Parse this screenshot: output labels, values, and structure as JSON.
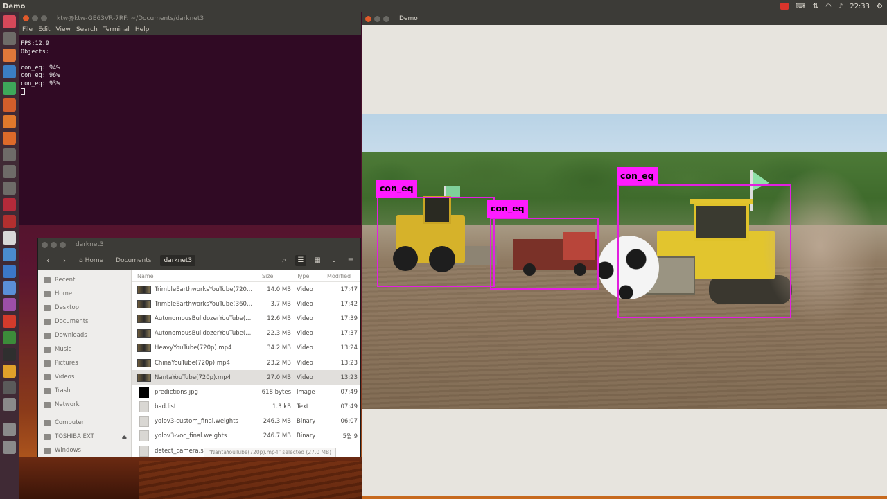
{
  "top_panel": {
    "title": "Demo",
    "clock": "22:33"
  },
  "terminal": {
    "title": "ktw@ktw-GE63VR-7RF: ~/Documents/darknet3",
    "menu": [
      "File",
      "Edit",
      "View",
      "Search",
      "Terminal",
      "Help"
    ],
    "lines": [
      "FPS:12.9",
      "Objects:",
      "",
      "con_eq: 94%",
      "con_eq: 96%",
      "con_eq: 93%"
    ]
  },
  "file_manager": {
    "title": "darknet3",
    "breadcrumb": [
      "Home",
      "Documents",
      "darknet3"
    ],
    "sidebar": [
      {
        "label": "Recent",
        "icon": "clock-icon"
      },
      {
        "label": "Home",
        "icon": "home-icon"
      },
      {
        "label": "Desktop",
        "icon": "folder-icon"
      },
      {
        "label": "Documents",
        "icon": "folder-icon"
      },
      {
        "label": "Downloads",
        "icon": "folder-icon"
      },
      {
        "label": "Music",
        "icon": "music-icon"
      },
      {
        "label": "Pictures",
        "icon": "picture-icon"
      },
      {
        "label": "Videos",
        "icon": "video-icon"
      },
      {
        "label": "Trash",
        "icon": "trash-icon"
      },
      {
        "label": "Network",
        "icon": "network-icon"
      },
      {
        "label": "Computer",
        "icon": "computer-icon"
      },
      {
        "label": "TOSHIBA EXT",
        "icon": "drive-icon"
      },
      {
        "label": "Windows",
        "icon": "drive-icon"
      }
    ],
    "columns": {
      "name": "Name",
      "size": "Size",
      "type": "Type",
      "modified": "Modified"
    },
    "files": [
      {
        "name": "TrimbleEarthworksYouTube(720...",
        "size": "14.0 MB",
        "type": "Video",
        "modified": "17:47",
        "thumb": "video"
      },
      {
        "name": "TrimbleEarthworksYouTube(360...",
        "size": "3.7 MB",
        "type": "Video",
        "modified": "17:42",
        "thumb": "video"
      },
      {
        "name": "AutonomousBulldozerYouTube(...",
        "size": "12.6 MB",
        "type": "Video",
        "modified": "17:39",
        "thumb": "video"
      },
      {
        "name": "AutonomousBulldozerYouTube(...",
        "size": "22.3 MB",
        "type": "Video",
        "modified": "17:37",
        "thumb": "video"
      },
      {
        "name": "HeavyYouTube(720p).mp4",
        "size": "34.2 MB",
        "type": "Video",
        "modified": "13:24",
        "thumb": "video"
      },
      {
        "name": "ChinaYouTube(720p).mp4",
        "size": "23.2 MB",
        "type": "Video",
        "modified": "13:23",
        "thumb": "video"
      },
      {
        "name": "NantaYouTube(720p).mp4",
        "size": "27.0 MB",
        "type": "Video",
        "modified": "13:23",
        "thumb": "video",
        "selected": true
      },
      {
        "name": "predictions.jpg",
        "size": "618 bytes",
        "type": "Image",
        "modified": "07:49",
        "thumb": "black"
      },
      {
        "name": "bad.list",
        "size": "1.3 kB",
        "type": "Text",
        "modified": "07:49",
        "thumb": "doc"
      },
      {
        "name": "yolov3-custom_final.weights",
        "size": "246.3 MB",
        "type": "Binary",
        "modified": "06:07",
        "thumb": "doc"
      },
      {
        "name": "yolov3-voc_final.weights",
        "size": "246.7 MB",
        "type": "Binary",
        "modified": "5월 9",
        "thumb": "doc"
      },
      {
        "name": "detect_camera.sh",
        "size": "",
        "type": "",
        "modified": "",
        "thumb": "doc"
      }
    ],
    "status": "\"NantaYouTube(720p).mp4\" selected (27.0 MB)"
  },
  "demo_window": {
    "title": "Demo",
    "detections": [
      {
        "label": "con_eq"
      },
      {
        "label": "con_eq"
      },
      {
        "label": "con_eq"
      }
    ]
  },
  "colors": {
    "detection": "#e21fe0",
    "terminal_bg": "#300a24"
  }
}
